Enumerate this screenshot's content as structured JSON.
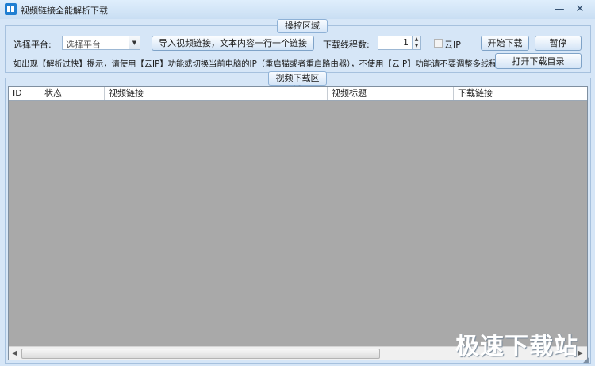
{
  "window": {
    "title": "视频链接全能解析下载",
    "minimize_glyph": "—",
    "close_glyph": "✕"
  },
  "control_area": {
    "label": "操控区域",
    "platform_label": "选择平台:",
    "platform_value": "选择平台",
    "import_button": "导入视频链接，文本内容一行一个链接",
    "threads_label": "下载线程数:",
    "threads_value": "1",
    "cloud_ip_label": "云IP",
    "cloud_ip_checked": false,
    "start_button": "开始下载",
    "pause_button": "暂停",
    "open_dir_button": "打开下载目录",
    "hint": "如出现【解析过快】提示，请使用【云IP】功能或切换当前电脑的IP（重启猫或者重启路由器），不使用【云IP】功能请不要调整多线程"
  },
  "download_area": {
    "label": "视频下载区域",
    "columns": [
      "ID",
      "状态",
      "视频链接",
      "视频标题",
      "下载链接"
    ],
    "rows": []
  },
  "watermark": "极速下载站",
  "colors": {
    "window_bg": "#d6e6f7",
    "table_bg": "#a9a9a9",
    "accent": "#1f7ed1"
  }
}
